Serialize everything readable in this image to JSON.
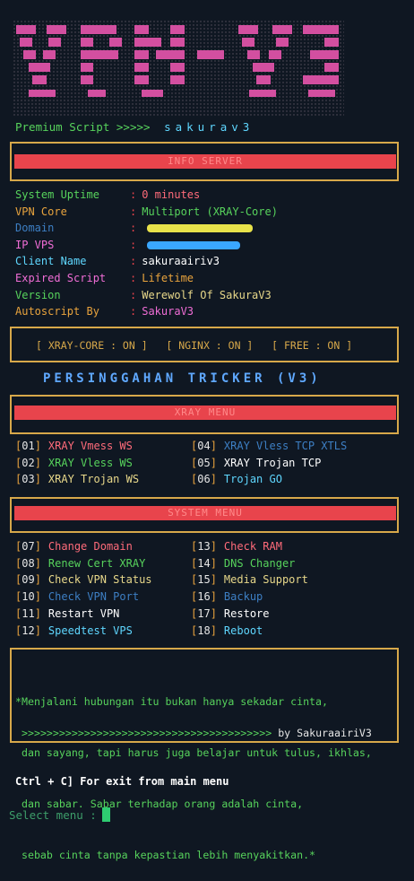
{
  "banner": {
    "title": "VPN-V3"
  },
  "premium": {
    "label": "Premium Script",
    "arrows": ">>>>>",
    "name": "sakurav3"
  },
  "info_header": "INFO SERVER",
  "info": [
    {
      "key": "System Uptime",
      "value": "0 minutes",
      "key_color": "#57d35c",
      "value_color": "#ff6b7a"
    },
    {
      "key": "VPN Core",
      "value": "Multiport (XRAY-Core)",
      "key_color": "#e8a33d",
      "value_color": "#57d35c"
    },
    {
      "key": "Domain",
      "value": "",
      "key_color": "#3d7fc4",
      "value_color": "#e6e6e6"
    },
    {
      "key": "IP VPS",
      "value": "",
      "key_color": "#f06dd6",
      "value_color": "#e6e6e6"
    },
    {
      "key": "Client Name",
      "value": "sakuraairiv3",
      "key_color": "#5fd7ff",
      "value_color": "#ffffff"
    },
    {
      "key": "Expired Script",
      "value": "Lifetime",
      "key_color": "#f06dd6",
      "value_color": "#e8a33d"
    },
    {
      "key": "Version",
      "value": "Werewolf Of SakuraV3",
      "key_color": "#57d35c",
      "value_color": "#e8d88a"
    },
    {
      "key": "Autoscript By",
      "value": "SakuraV3",
      "key_color": "#e8a33d",
      "value_color": "#f06dd6"
    }
  ],
  "status": {
    "xray": "[ XRAY-CORE : ON ]",
    "nginx": "[ NGINX : ON ]",
    "free": "[ FREE : ON ]"
  },
  "tricker": "PERSINGGAHAN TRICKER (V3)",
  "xray_header": "XRAY MENU",
  "xray_menu": [
    {
      "num": "01",
      "label": "XRAY Vmess WS",
      "color": "#ff6b7a"
    },
    {
      "num": "04",
      "label": "XRAY Vless TCP XTLS",
      "color": "#3d7fc4"
    },
    {
      "num": "02",
      "label": "XRAY Vless WS",
      "color": "#57d35c"
    },
    {
      "num": "05",
      "label": "XRAY Trojan TCP",
      "color": "#ffffff"
    },
    {
      "num": "03",
      "label": "XRAY Trojan WS",
      "color": "#e8d88a"
    },
    {
      "num": "06",
      "label": "Trojan GO",
      "color": "#5fd7ff"
    }
  ],
  "system_header": "SYSTEM MENU",
  "system_menu": [
    {
      "num": "07",
      "label": "Change Domain",
      "color": "#ff6b7a"
    },
    {
      "num": "13",
      "label": "Check RAM",
      "color": "#ff6b7a"
    },
    {
      "num": "08",
      "label": "Renew Cert XRAY",
      "color": "#57d35c"
    },
    {
      "num": "14",
      "label": "DNS Changer",
      "color": "#57d35c"
    },
    {
      "num": "09",
      "label": "Check VPN Status",
      "color": "#e8d88a"
    },
    {
      "num": "15",
      "label": "Media Support",
      "color": "#e8d88a"
    },
    {
      "num": "10",
      "label": "Check VPN Port",
      "color": "#3d7fc4"
    },
    {
      "num": "16",
      "label": "Backup",
      "color": "#3d7fc4"
    },
    {
      "num": "11",
      "label": "Restart VPN",
      "color": "#ffffff"
    },
    {
      "num": "17",
      "label": "Restore",
      "color": "#ffffff"
    },
    {
      "num": "12",
      "label": "Speedtest VPS",
      "color": "#5fd7ff"
    },
    {
      "num": "18",
      "label": "Reboot",
      "color": "#5fd7ff"
    }
  ],
  "quote": {
    "lines": [
      "*Menjalani hubungan itu bukan hanya sekadar cinta,",
      " dan sayang, tapi harus juga belajar untuk tulus, ikhlas,",
      " dan sabar. Sabar terhadap orang adalah cinta,",
      " sebab cinta tanpa kepastian lebih menyakitkan.*"
    ],
    "arrows": ">>>>>>>>>>>>>>>>>>>>>>>>>>>>>>>>>>>>>>>>",
    "by": "by SakuraairiV3"
  },
  "exit_text": "Ctrl + C] For exit from main menu",
  "prompt": "Select menu :",
  "colors": {
    "accent_red": "#e8444c",
    "frame": "#d7a84a",
    "bg": "#0f1722"
  }
}
